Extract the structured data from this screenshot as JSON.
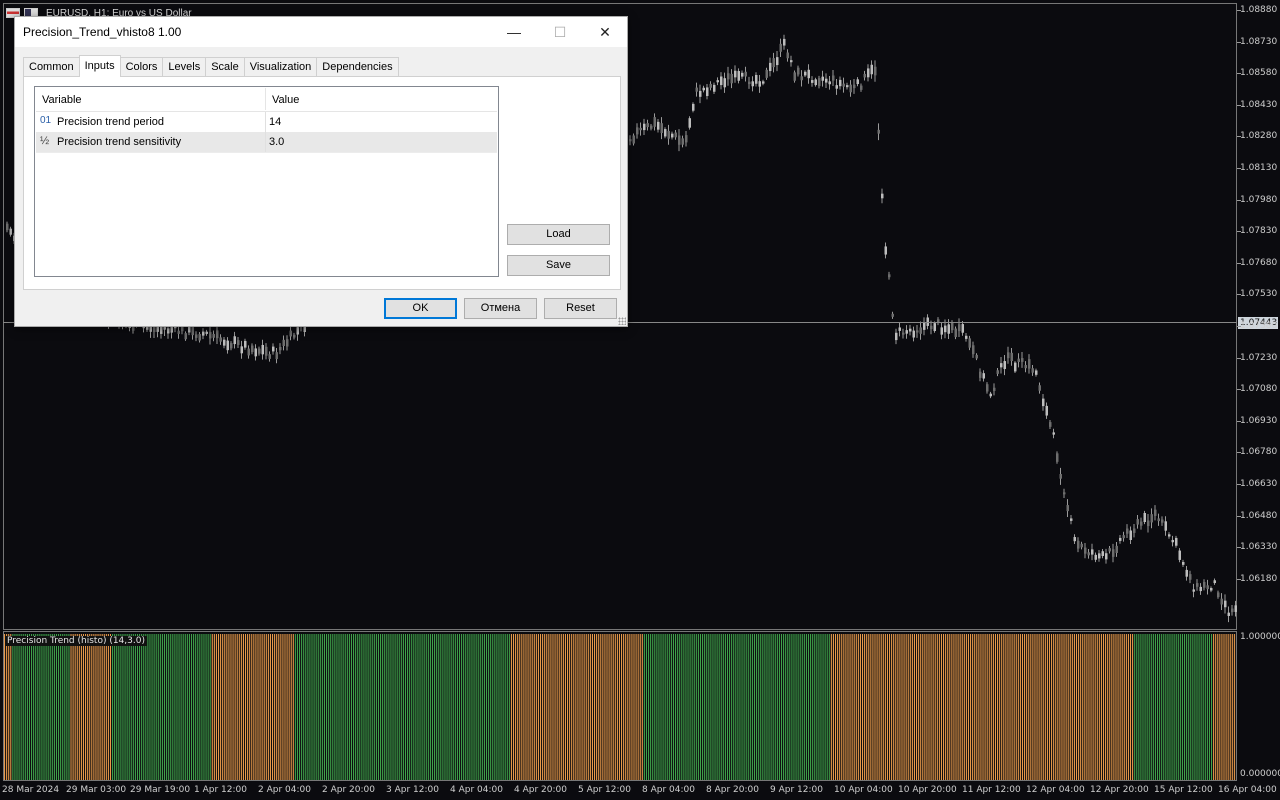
{
  "chart": {
    "symbol_title": "EURUSD, H1:  Euro vs US Dollar",
    "current_price": "1.07443",
    "price_ticks": [
      "1.08880",
      "1.08730",
      "1.08580",
      "1.08430",
      "1.08280",
      "1.08130",
      "1.07980",
      "1.07830",
      "1.07680",
      "1.07530",
      "1.07380",
      "1.07230",
      "1.07080",
      "1.06930",
      "1.06780",
      "1.06630",
      "1.06480",
      "1.06330",
      "1.06180"
    ],
    "time_ticks": [
      "28 Mar 2024",
      "29 Mar 03:00",
      "29 Mar 19:00",
      "1 Apr 12:00",
      "2 Apr 04:00",
      "2 Apr 20:00",
      "3 Apr 12:00",
      "4 Apr 04:00",
      "4 Apr 20:00",
      "5 Apr 12:00",
      "8 Apr 04:00",
      "8 Apr 20:00",
      "9 Apr 12:00",
      "10 Apr 04:00",
      "10 Apr 20:00",
      "11 Apr 12:00",
      "12 Apr 04:00",
      "12 Apr 20:00",
      "15 Apr 12:00",
      "16 Apr 04:00"
    ],
    "indicator": {
      "label": "Precision Trend (histo) (14,3.0)",
      "scale_top": "1.000000",
      "scale_bottom": "0.000000",
      "colors": {
        "up": "#3fa34a",
        "down": "#e89a4a"
      },
      "segments": [
        {
          "state": "down",
          "bars": 4
        },
        {
          "state": "green",
          "bars": 28
        },
        {
          "state": "down",
          "bars": 20
        },
        {
          "state": "green",
          "bars": 48
        },
        {
          "state": "down",
          "bars": 40
        },
        {
          "state": "green",
          "bars": 104
        },
        {
          "state": "down",
          "bars": 64
        },
        {
          "state": "green",
          "bars": 90
        },
        {
          "state": "down",
          "bars": 146
        },
        {
          "state": "green",
          "bars": 38
        },
        {
          "state": "down",
          "bars": 12
        }
      ]
    }
  },
  "dialog": {
    "title": "Precision_Trend_vhisto8 1.00",
    "minimize": "—",
    "maximize": "☐",
    "close": "✕",
    "tabs": [
      "Common",
      "Inputs",
      "Colors",
      "Levels",
      "Scale",
      "Visualization",
      "Dependencies"
    ],
    "active_tab": "Inputs",
    "grid": {
      "col_variable": "Variable",
      "col_value": "Value",
      "rows": [
        {
          "icon": "01",
          "name": "Precision trend period",
          "value": "14"
        },
        {
          "icon": "½",
          "name": "Precision trend sensitivity",
          "value": "3.0"
        }
      ]
    },
    "load": "Load",
    "save": "Save",
    "ok": "OK",
    "cancel": "Отмена",
    "reset": "Reset"
  }
}
